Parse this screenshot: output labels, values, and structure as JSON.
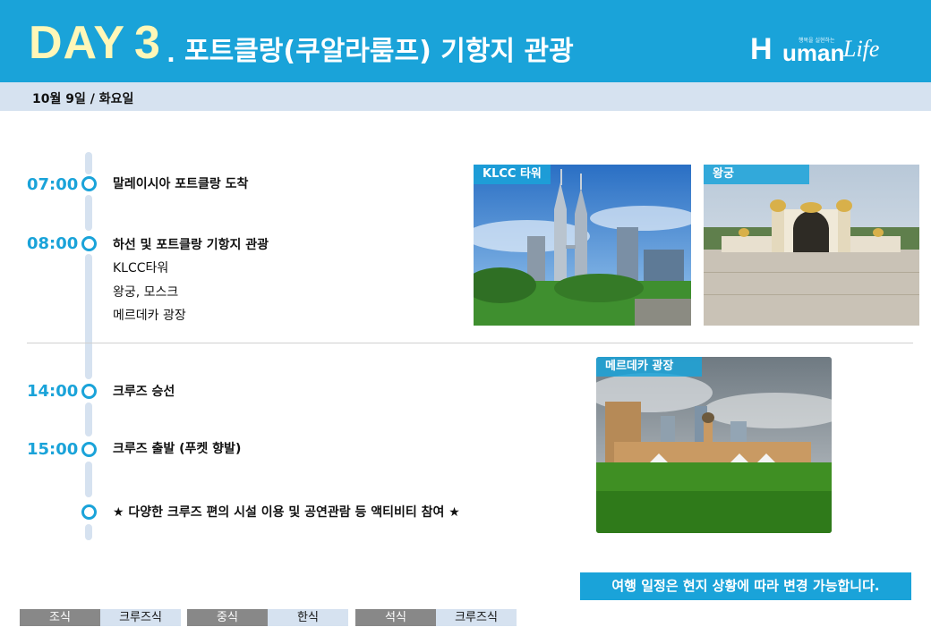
{
  "header": {
    "day_label": "DAY",
    "day_number": "3",
    "dot": ".",
    "title": "포트클랑(쿠알라룸프) 기항지 관광",
    "logo": {
      "h": "H",
      "uman": "uman",
      "life": "Life",
      "tagline": "행복을 실현하는"
    }
  },
  "date": "10월 9일 / 화요일",
  "schedule": [
    {
      "time": "07:00",
      "items": [
        "말레이시아 포트클랑 도착"
      ]
    },
    {
      "time": "08:00",
      "items": [
        "하선 및 포트클랑 기항지 관광",
        "KLCC타워",
        "왕궁, 모스크",
        "메르데카 광장"
      ]
    },
    {
      "time": "14:00",
      "items": [
        "크루즈 승선"
      ]
    },
    {
      "time": "15:00",
      "items": [
        "크루즈 출발 (푸켓 향발)"
      ]
    },
    {
      "time": "",
      "items": [
        "★ 다양한 크루즈 편의 시설 이용 및 공연관람 등 액티비티 참여 ★"
      ]
    }
  ],
  "photos": [
    {
      "label": "KLCC 타워"
    },
    {
      "label": "왕궁"
    },
    {
      "label": "메르데카 광장"
    }
  ],
  "notice": "여행 일정은 현지 상황에 따라 변경 가능합니다.",
  "meals": [
    {
      "label": "조식",
      "value": "크루즈식"
    },
    {
      "label": "중식",
      "value": "한식"
    },
    {
      "label": "석식",
      "value": "크루즈식"
    }
  ],
  "colors": {
    "accent": "#1aa3d9",
    "day_text": "#fff7b8",
    "bar": "#d6e2f0",
    "meal_label": "#888888"
  }
}
